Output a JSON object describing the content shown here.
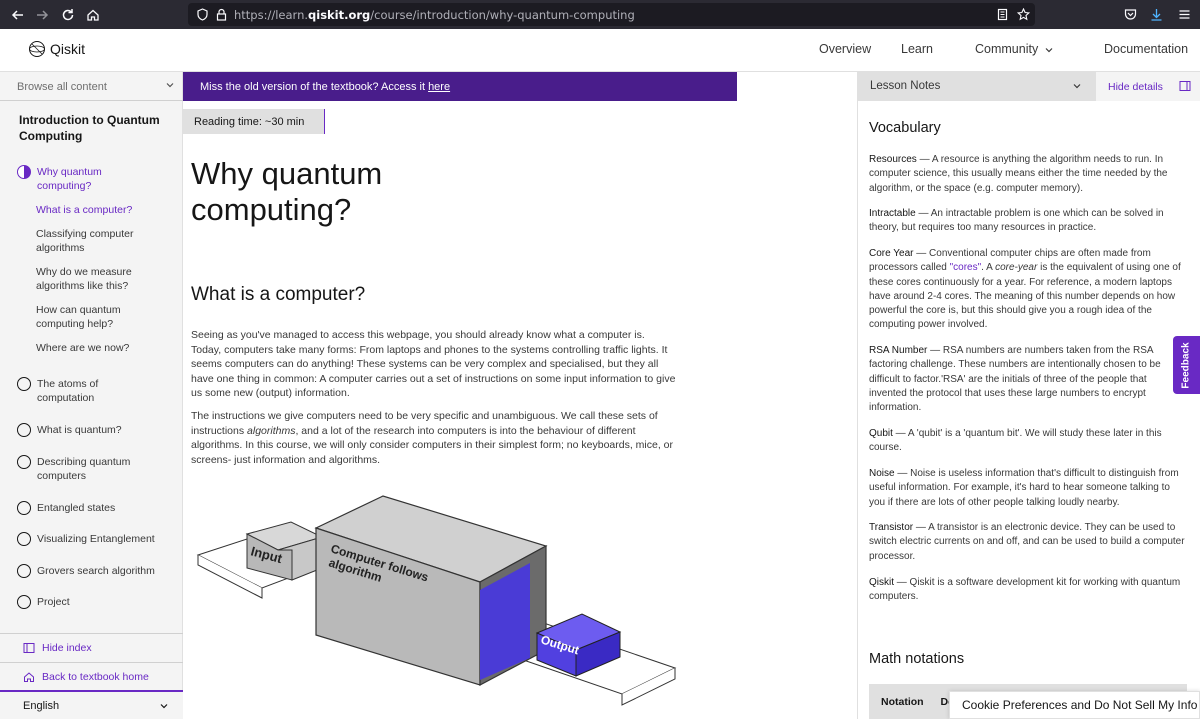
{
  "browser": {
    "url_prefix": "https://learn.",
    "url_domain": "qiskit.org",
    "url_path": "/course/introduction/why-quantum-computing"
  },
  "header": {
    "logo_text": "Qiskit",
    "nav": [
      "Overview",
      "Learn",
      "Community",
      "Documentation"
    ]
  },
  "sidebar": {
    "browse_label": "Browse all content",
    "course_title": "Introduction to Quantum Computing",
    "chapters": [
      {
        "label": "Why quantum computing?",
        "sections": [
          "What is a computer?",
          "Classifying computer algorithms",
          "Why do we measure algorithms like this?",
          "How can quantum computing help?",
          "Where are we now?"
        ]
      },
      {
        "label": "The atoms of computation"
      },
      {
        "label": "What is quantum?"
      },
      {
        "label": "Describing quantum computers"
      },
      {
        "label": "Entangled states"
      },
      {
        "label": "Visualizing Entanglement"
      },
      {
        "label": "Grovers search algorithm"
      },
      {
        "label": "Project"
      }
    ],
    "hide_index": "Hide index",
    "back_home": "Back to textbook home",
    "language": "English"
  },
  "main": {
    "banner_text": "Miss the old version of the textbook? Access it ",
    "banner_link": "here",
    "reading_time": "Reading time: ~30 min",
    "title": "Why quantum computing?",
    "section_heading": "What is a computer?",
    "para1": "Seeing as you've managed to access this webpage, you should already know what a computer is. Today, computers take many forms: From laptops and phones to the systems controlling traffic lights. It seems computers can do anything! These systems can be very complex and specialised, but they all have one thing in common: A computer carries out a set of instructions on some input information to give us some new (output) information.",
    "para2_a": "The instructions we give computers need to be very specific and unambiguous. We call these sets of instructions ",
    "para2_em": "algorithms",
    "para2_b": ", and a lot of the research into computers is into the behaviour of different algorithms. In this course, we will only consider computers in their simplest form; no keyboards, mice, or screens- just information and algorithms.",
    "illustration": {
      "input": "Input",
      "computer_1": "Computer follows",
      "computer_2": "algorithm",
      "output": "Output"
    }
  },
  "notes": {
    "panel_label": "Lesson Notes",
    "hide_details": "Hide details",
    "vocab_title": "Vocabulary",
    "vocab": [
      {
        "term": "Resources",
        "text": " — A resource is anything the algorithm needs to run. In computer science, this usually means either the time needed by the algorithm, or the space (e.g. computer memory)."
      },
      {
        "term": "Intractable",
        "text": " — An intractable problem is one which can be solved in theory, but requires too many resources in practice."
      },
      {
        "term": "Core Year",
        "text_a": " — Conventional computer chips are often made from processors called ",
        "link": "\"cores\"",
        "text_b": ". A ",
        "em": "core-year",
        "text_c": " is the equivalent of using one of these cores continuously for a year. For reference, a modern laptops have around 2-4 cores. The meaning of this number depends on how powerful the core is, but this should give you a rough idea of the computing power involved."
      },
      {
        "term": "RSA Number",
        "text": " — RSA numbers are numbers taken from the RSA factoring challenge. These numbers are intentionally chosen to be difficult to factor.'RSA' are the initials of three of the people that invented the protocol that uses these large numbers to encrypt information."
      },
      {
        "term": "Qubit",
        "text": " — A 'qubit' is a 'quantum bit'. We will study these later in this course."
      },
      {
        "term": "Noise",
        "text": " — Noise is useless information that's difficult to distinguish from useful information. For example, it's hard to hear someone talking to you if there are lots of other people talking loudly nearby."
      },
      {
        "term": "Transistor",
        "text": " — A transistor is an electronic device. They can be used to switch electric currents on and off, and can be used to build a computer processor."
      },
      {
        "term": "Qiskit",
        "text": " — Qiskit is a software development kit for working with quantum computers."
      }
    ],
    "math_title": "Math notations",
    "table_header": "Notation",
    "table_header_2": "De"
  },
  "feedback": "Feedback",
  "cookie": "Cookie Preferences and Do Not Sell My Info",
  "colors": {
    "accent": "#6929c4",
    "banner": "#491d8b",
    "chrome": "#2b2a33"
  }
}
